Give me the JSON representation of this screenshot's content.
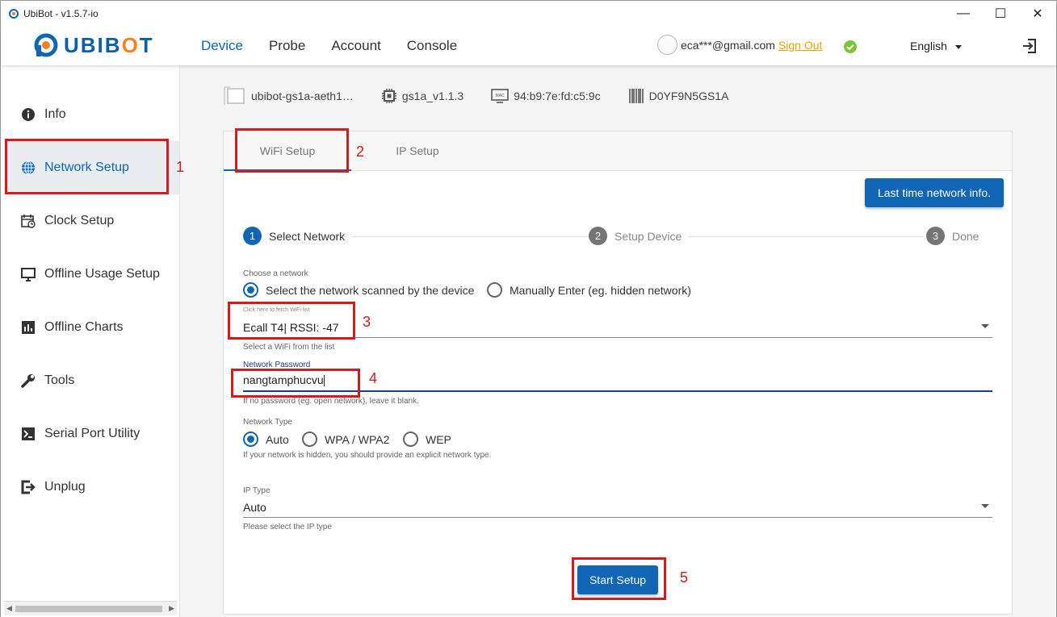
{
  "window": {
    "title": "UbiBot - v1.5.7-io",
    "controls": {
      "minimize": "—",
      "maximize": "☐",
      "close": "✕"
    }
  },
  "header": {
    "logo_text": "UBIBOT",
    "nav": [
      {
        "label": "Device",
        "active": true
      },
      {
        "label": "Probe",
        "active": false
      },
      {
        "label": "Account",
        "active": false
      },
      {
        "label": "Console",
        "active": false
      }
    ],
    "user_email": "eca***@gmail.com",
    "sign_out": "Sign Out",
    "status_icon": "check-circle-icon",
    "language": "English"
  },
  "sidebar": {
    "items": [
      {
        "label": "Info",
        "icon": "info-icon",
        "active": false
      },
      {
        "label": "Network Setup",
        "icon": "globe-icon",
        "active": true
      },
      {
        "label": "Clock Setup",
        "icon": "calendar-icon",
        "active": false
      },
      {
        "label": "Offline Usage Setup",
        "icon": "monitor-icon",
        "active": false
      },
      {
        "label": "Offline Charts",
        "icon": "bar-chart-icon",
        "active": false
      },
      {
        "label": "Tools",
        "icon": "wrench-icon",
        "active": false
      },
      {
        "label": "Serial Port Utility",
        "icon": "terminal-icon",
        "active": false
      },
      {
        "label": "Unplug",
        "icon": "unplug-icon",
        "active": false
      }
    ]
  },
  "device_info": {
    "name": "ubibot-gs1a-aeth1…",
    "firmware": "gs1a_v1.1.3",
    "mac": "94:b9:7e:fd:c5:9c",
    "serial": "D0YF9N5GS1A",
    "mac_badge": "MAC"
  },
  "tabs": [
    {
      "label": "WiFi Setup",
      "active": true
    },
    {
      "label": "IP Setup",
      "active": false
    }
  ],
  "last_info_button": "Last time network info.",
  "steps": [
    {
      "num": "1",
      "label": "Select Network",
      "active": true
    },
    {
      "num": "2",
      "label": "Setup Device",
      "active": false
    },
    {
      "num": "3",
      "label": "Done",
      "active": false
    }
  ],
  "form": {
    "choose_network_label": "Choose a network",
    "network_options": [
      {
        "label": "Select the network scanned by the device",
        "selected": true
      },
      {
        "label": "Manually Enter (eg. hidden network)",
        "selected": false
      }
    ],
    "wifi_fetch_label": "Click here to fetch WiFi list",
    "wifi_value": "Ecall T4| RSSI: -47",
    "wifi_helper": "Select a WiFi from the list",
    "password_label": "Network Password",
    "password_value": "nangtamphucvu",
    "password_helper": "If no password (eg. open network), leave it blank.",
    "network_type_label": "Network Type",
    "network_types": [
      {
        "label": "Auto",
        "selected": true
      },
      {
        "label": "WPA / WPA2",
        "selected": false
      },
      {
        "label": "WEP",
        "selected": false
      }
    ],
    "network_type_helper": "If your network is hidden, you should provide an explicit network type.",
    "ip_type_label": "IP Type",
    "ip_type_value": "Auto",
    "ip_type_helper": "Please select the IP type"
  },
  "start_button": "Start Setup",
  "annotations": [
    "1",
    "2",
    "3",
    "4",
    "5"
  ],
  "colors": {
    "primary": "#1066b4",
    "accent": "#f58220",
    "annotation": "#d41c1c",
    "success": "#7cc33a",
    "signout": "#e5a600"
  }
}
